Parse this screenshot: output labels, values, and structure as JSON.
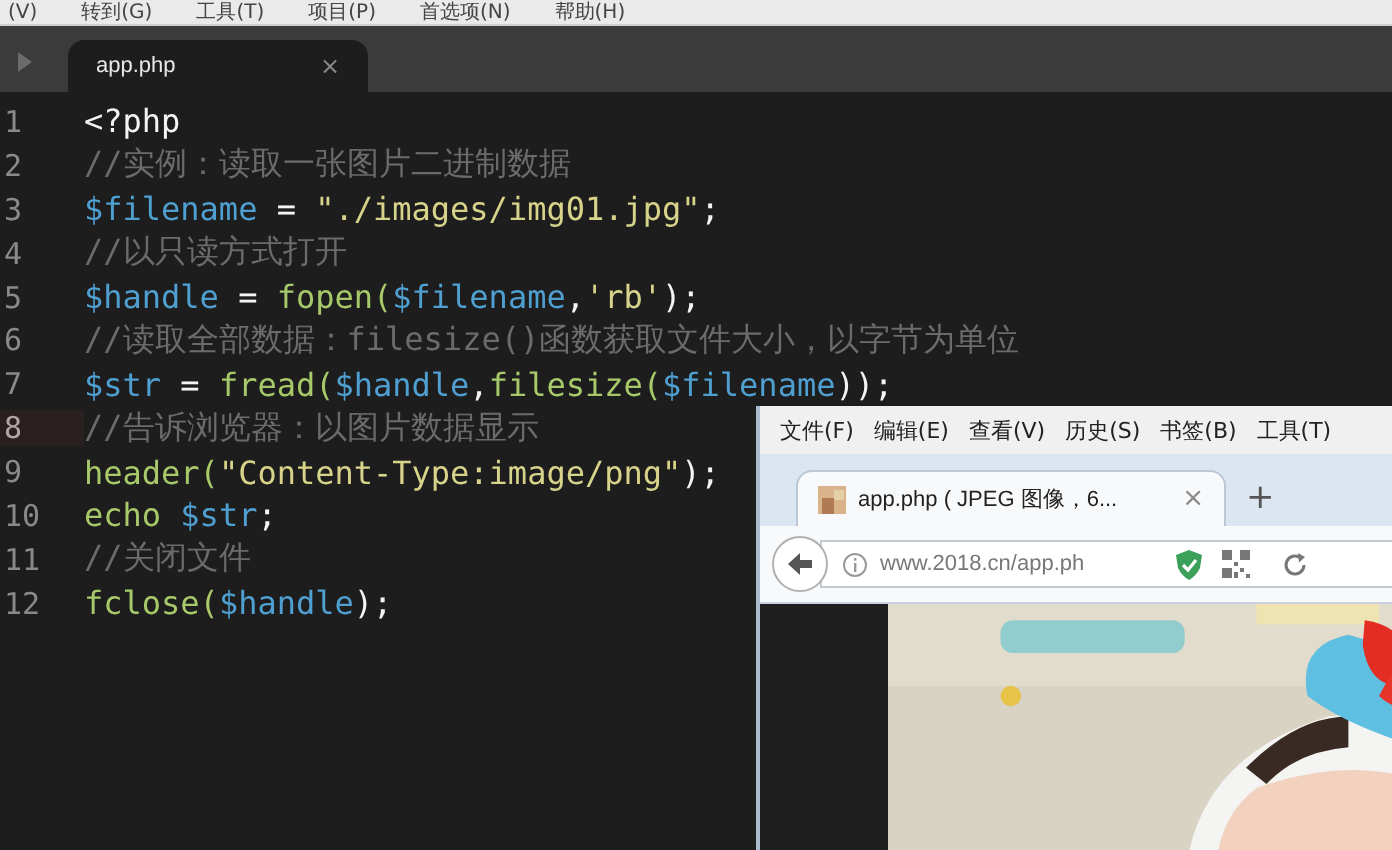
{
  "menu_bar": {
    "items": [
      "(V)",
      "转到(G)",
      "工具(T)",
      "项目(P)",
      "首选项(N)",
      "帮助(H)"
    ]
  },
  "tabs": [
    {
      "label": "app.php",
      "selected": true,
      "close": "×"
    }
  ],
  "editor": {
    "lines": [
      {
        "number": "1",
        "current": false,
        "tokens": [
          {
            "kind": "plain",
            "text": "<?php"
          }
        ]
      },
      {
        "number": "2",
        "current": false,
        "tokens": [
          {
            "kind": "comment",
            "text": "//实例：读取一张图片二进制数据"
          }
        ]
      },
      {
        "number": "3",
        "current": false,
        "tokens": [
          {
            "kind": "variable",
            "text": "$filename"
          },
          {
            "kind": "plain",
            "text": " = "
          },
          {
            "kind": "string",
            "text": "\"./images/img01.jpg\""
          },
          {
            "kind": "plain",
            "text": ";"
          }
        ]
      },
      {
        "number": "4",
        "current": false,
        "tokens": [
          {
            "kind": "comment",
            "text": "//以只读方式打开"
          }
        ]
      },
      {
        "number": "5",
        "current": false,
        "tokens": [
          {
            "kind": "variable",
            "text": "$handle"
          },
          {
            "kind": "plain",
            "text": " = "
          },
          {
            "kind": "function",
            "text": "fopen("
          },
          {
            "kind": "variable",
            "text": "$filename"
          },
          {
            "kind": "plain",
            "text": ","
          },
          {
            "kind": "string",
            "text": "'rb'"
          },
          {
            "kind": "plain",
            "text": ");"
          }
        ]
      },
      {
        "number": "6",
        "current": false,
        "tokens": [
          {
            "kind": "comment",
            "text": "//读取全部数据：filesize()函数获取文件大小，以字节为单位"
          }
        ]
      },
      {
        "number": "7",
        "current": false,
        "tokens": [
          {
            "kind": "variable",
            "text": "$str"
          },
          {
            "kind": "plain",
            "text": " = "
          },
          {
            "kind": "function",
            "text": "fread("
          },
          {
            "kind": "variable",
            "text": "$handle"
          },
          {
            "kind": "plain",
            "text": ","
          },
          {
            "kind": "function",
            "text": "filesize("
          },
          {
            "kind": "variable",
            "text": "$filename"
          },
          {
            "kind": "plain",
            "text": "));"
          }
        ]
      },
      {
        "number": "8",
        "current": true,
        "tokens": [
          {
            "kind": "comment",
            "text": "//告诉浏览器：以图片数据显示"
          }
        ]
      },
      {
        "number": "9",
        "current": false,
        "tokens": [
          {
            "kind": "function",
            "text": "header("
          },
          {
            "kind": "string",
            "text": "\"Content-Type:image/png\""
          },
          {
            "kind": "plain",
            "text": ");"
          }
        ]
      },
      {
        "number": "10",
        "current": false,
        "tokens": [
          {
            "kind": "function",
            "text": "echo "
          },
          {
            "kind": "variable",
            "text": "$str"
          },
          {
            "kind": "plain",
            "text": ";"
          }
        ]
      },
      {
        "number": "11",
        "current": false,
        "tokens": [
          {
            "kind": "comment",
            "text": "//关闭文件"
          }
        ]
      },
      {
        "number": "12",
        "current": false,
        "tokens": [
          {
            "kind": "function",
            "text": "fclose("
          },
          {
            "kind": "variable",
            "text": "$handle"
          },
          {
            "kind": "plain",
            "text": ");"
          }
        ]
      }
    ]
  },
  "browser": {
    "menu_items": [
      "文件(F)",
      "编辑(E)",
      "查看(V)",
      "历史(S)",
      "书签(B)",
      "工具(T)"
    ],
    "tabs": [
      {
        "label": "app.php ( JPEG 图像，6...",
        "selected": true,
        "close": "×"
      }
    ],
    "new_tab": "+",
    "address": "www.2018.cn/app.ph",
    "content": {
      "kind": "picture"
    }
  }
}
